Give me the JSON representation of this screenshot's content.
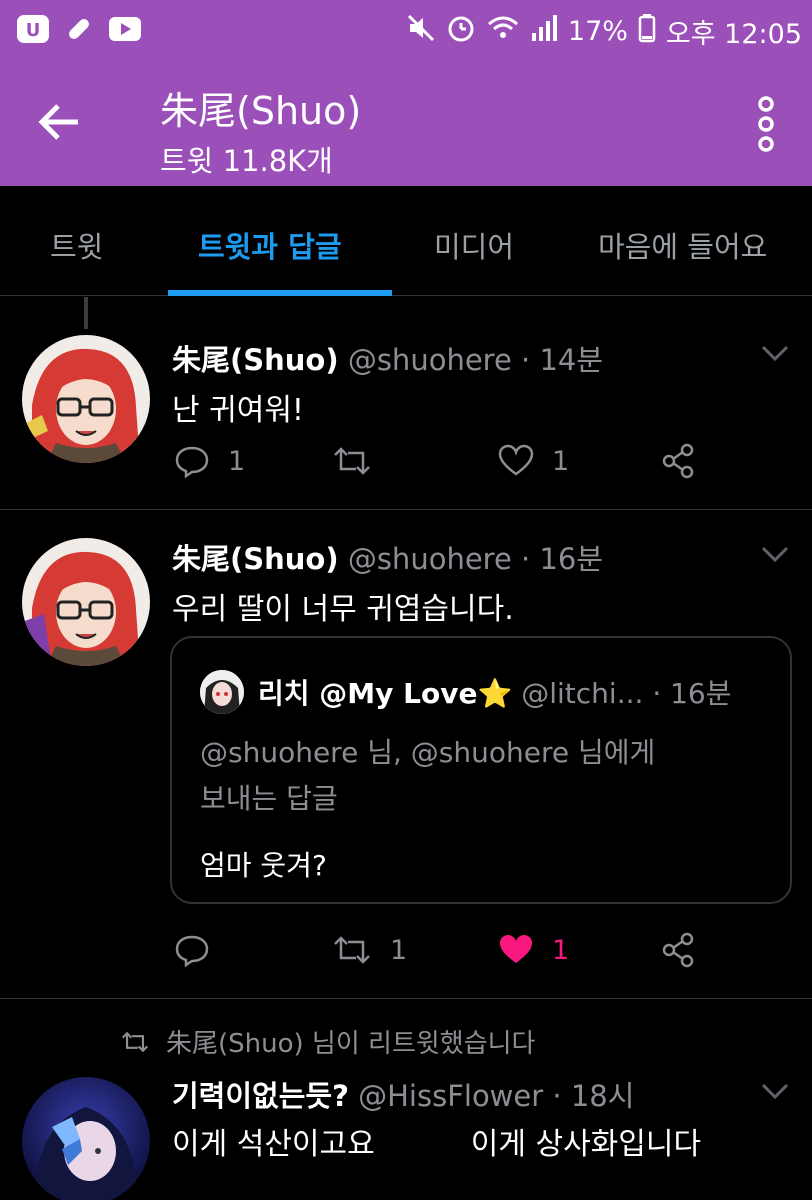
{
  "status_bar": {
    "battery": "17%",
    "time": "오후 12:05",
    "icons": [
      "app-icon",
      "pill-icon",
      "youtube-icon",
      "mute-icon",
      "alarm-icon",
      "wifi-icon",
      "signal-icon",
      "battery-icon"
    ]
  },
  "header": {
    "title": "朱尾(Shuo)",
    "subtitle": "트윗 11.8K개"
  },
  "tabs": [
    "트윗",
    "트윗과 답글",
    "미디어",
    "마음에 들어요"
  ],
  "tweets": [
    {
      "name": "朱尾(Shuo)",
      "handle": "@shuohere",
      "time": "· 14분",
      "text": "난 귀여워!",
      "replies": "1",
      "retweets": "",
      "likes": "1"
    },
    {
      "name": "朱尾(Shuo)",
      "handle": "@shuohere",
      "time": "· 16분",
      "text": "우리 딸이 너무 귀엽습니다.",
      "quote": {
        "name": "리치 @My Love⭐",
        "handle": "@litchi...",
        "time": "· 16분",
        "reply_line1": "@shuohere 님, @shuohere 님에게",
        "reply_line2": "보내는 답글",
        "text": "엄마 웃겨?"
      },
      "replies": "",
      "retweets": "1",
      "likes": "1"
    },
    {
      "retweeted_by": "朱尾(Shuo) 님이 리트윗했습니다",
      "name": "기력이없는듯?",
      "handle": "@HissFlower",
      "time": "· 18시",
      "text_part1": "이게 석산이고요",
      "text_part2": "이게 상사화입니다"
    }
  ],
  "colors": {
    "header_bg": "#9b4fb8",
    "accent": "#1d9bf0",
    "like": "#f91880",
    "muted": "#8b8f94"
  }
}
